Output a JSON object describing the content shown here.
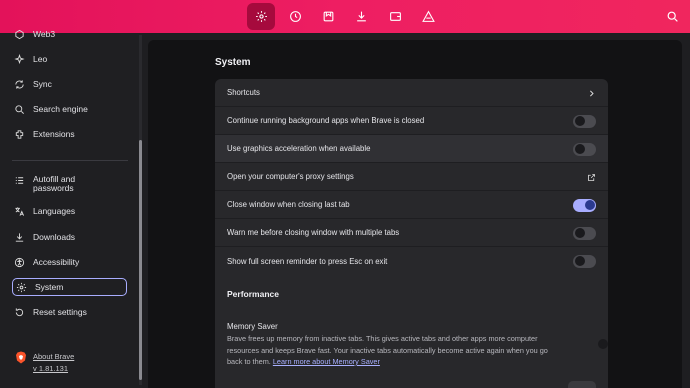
{
  "topbar": {
    "buttons": [
      {
        "icon": "gear-icon",
        "active": true
      },
      {
        "icon": "history-icon"
      },
      {
        "icon": "bookmarks-icon"
      },
      {
        "icon": "downloads-icon"
      },
      {
        "icon": "wallet-icon"
      },
      {
        "icon": "brave-rewards-icon"
      }
    ],
    "search_icon": "search-icon",
    "colors": {
      "start": "#e3125a",
      "end": "#f0265e"
    }
  },
  "sidebar": {
    "items": [
      {
        "label": "Web3",
        "icon": "web3-icon"
      },
      {
        "label": "Leo",
        "icon": "leo-icon"
      },
      {
        "label": "Sync",
        "icon": "sync-icon"
      },
      {
        "label": "Search engine",
        "icon": "search-icon"
      },
      {
        "label": "Extensions",
        "icon": "extensions-icon"
      },
      {
        "label": "Autofill and passwords",
        "icon": "autofill-icon"
      },
      {
        "label": "Languages",
        "icon": "languages-icon"
      },
      {
        "label": "Downloads",
        "icon": "download-icon"
      },
      {
        "label": "Accessibility",
        "icon": "accessibility-icon"
      },
      {
        "label": "System",
        "icon": "gear-icon",
        "selected": true
      },
      {
        "label": "Reset settings",
        "icon": "reset-icon"
      }
    ],
    "about_label": "About Brave",
    "version": "v 1.81.131"
  },
  "main": {
    "section_title": "System",
    "rows": [
      {
        "label": "Shortcuts",
        "control": "chevron"
      },
      {
        "label": "Continue running background apps when Brave is closed",
        "control": "toggle",
        "on": false
      },
      {
        "label": "Use graphics acceleration when available",
        "control": "toggle",
        "on": false
      },
      {
        "label": "Open your computer's proxy settings",
        "control": "external"
      },
      {
        "label": "Close window when closing last tab",
        "control": "toggle",
        "on": true
      },
      {
        "label": "Warn me before closing window with multiple tabs",
        "control": "toggle",
        "on": false
      },
      {
        "label": "Show full screen reminder to press Esc on exit",
        "control": "toggle",
        "on": false
      }
    ],
    "performance_title": "Performance",
    "memory_saver": {
      "title": "Memory Saver",
      "description": "Brave frees up memory from inactive tabs. This gives active tabs and other apps more computer resources and keeps Brave fast. Your inactive tabs automatically become active again when you go back to them.",
      "link": "Learn more about Memory Saver",
      "on": false
    },
    "accent_color": "#a8adff"
  }
}
